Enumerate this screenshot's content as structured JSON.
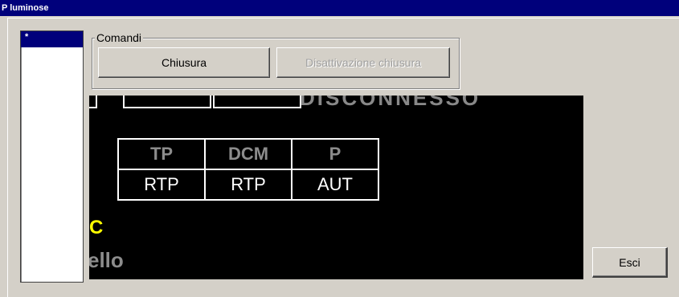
{
  "window": {
    "title": "P luminose"
  },
  "list": {
    "items": [
      "*"
    ]
  },
  "commands": {
    "group_label": "Comandi",
    "chiusura_label": "Chiusura",
    "disattivazione_label": "Disattivazione chiusura"
  },
  "screen": {
    "status_text": "DISCONNESSO",
    "table": {
      "headers": [
        "TP",
        "DCM",
        "P"
      ],
      "values": [
        "RTP",
        "RTP",
        "AUT"
      ]
    },
    "label_c": "C",
    "label_ello": "ello"
  },
  "exit_label": "Esci"
}
